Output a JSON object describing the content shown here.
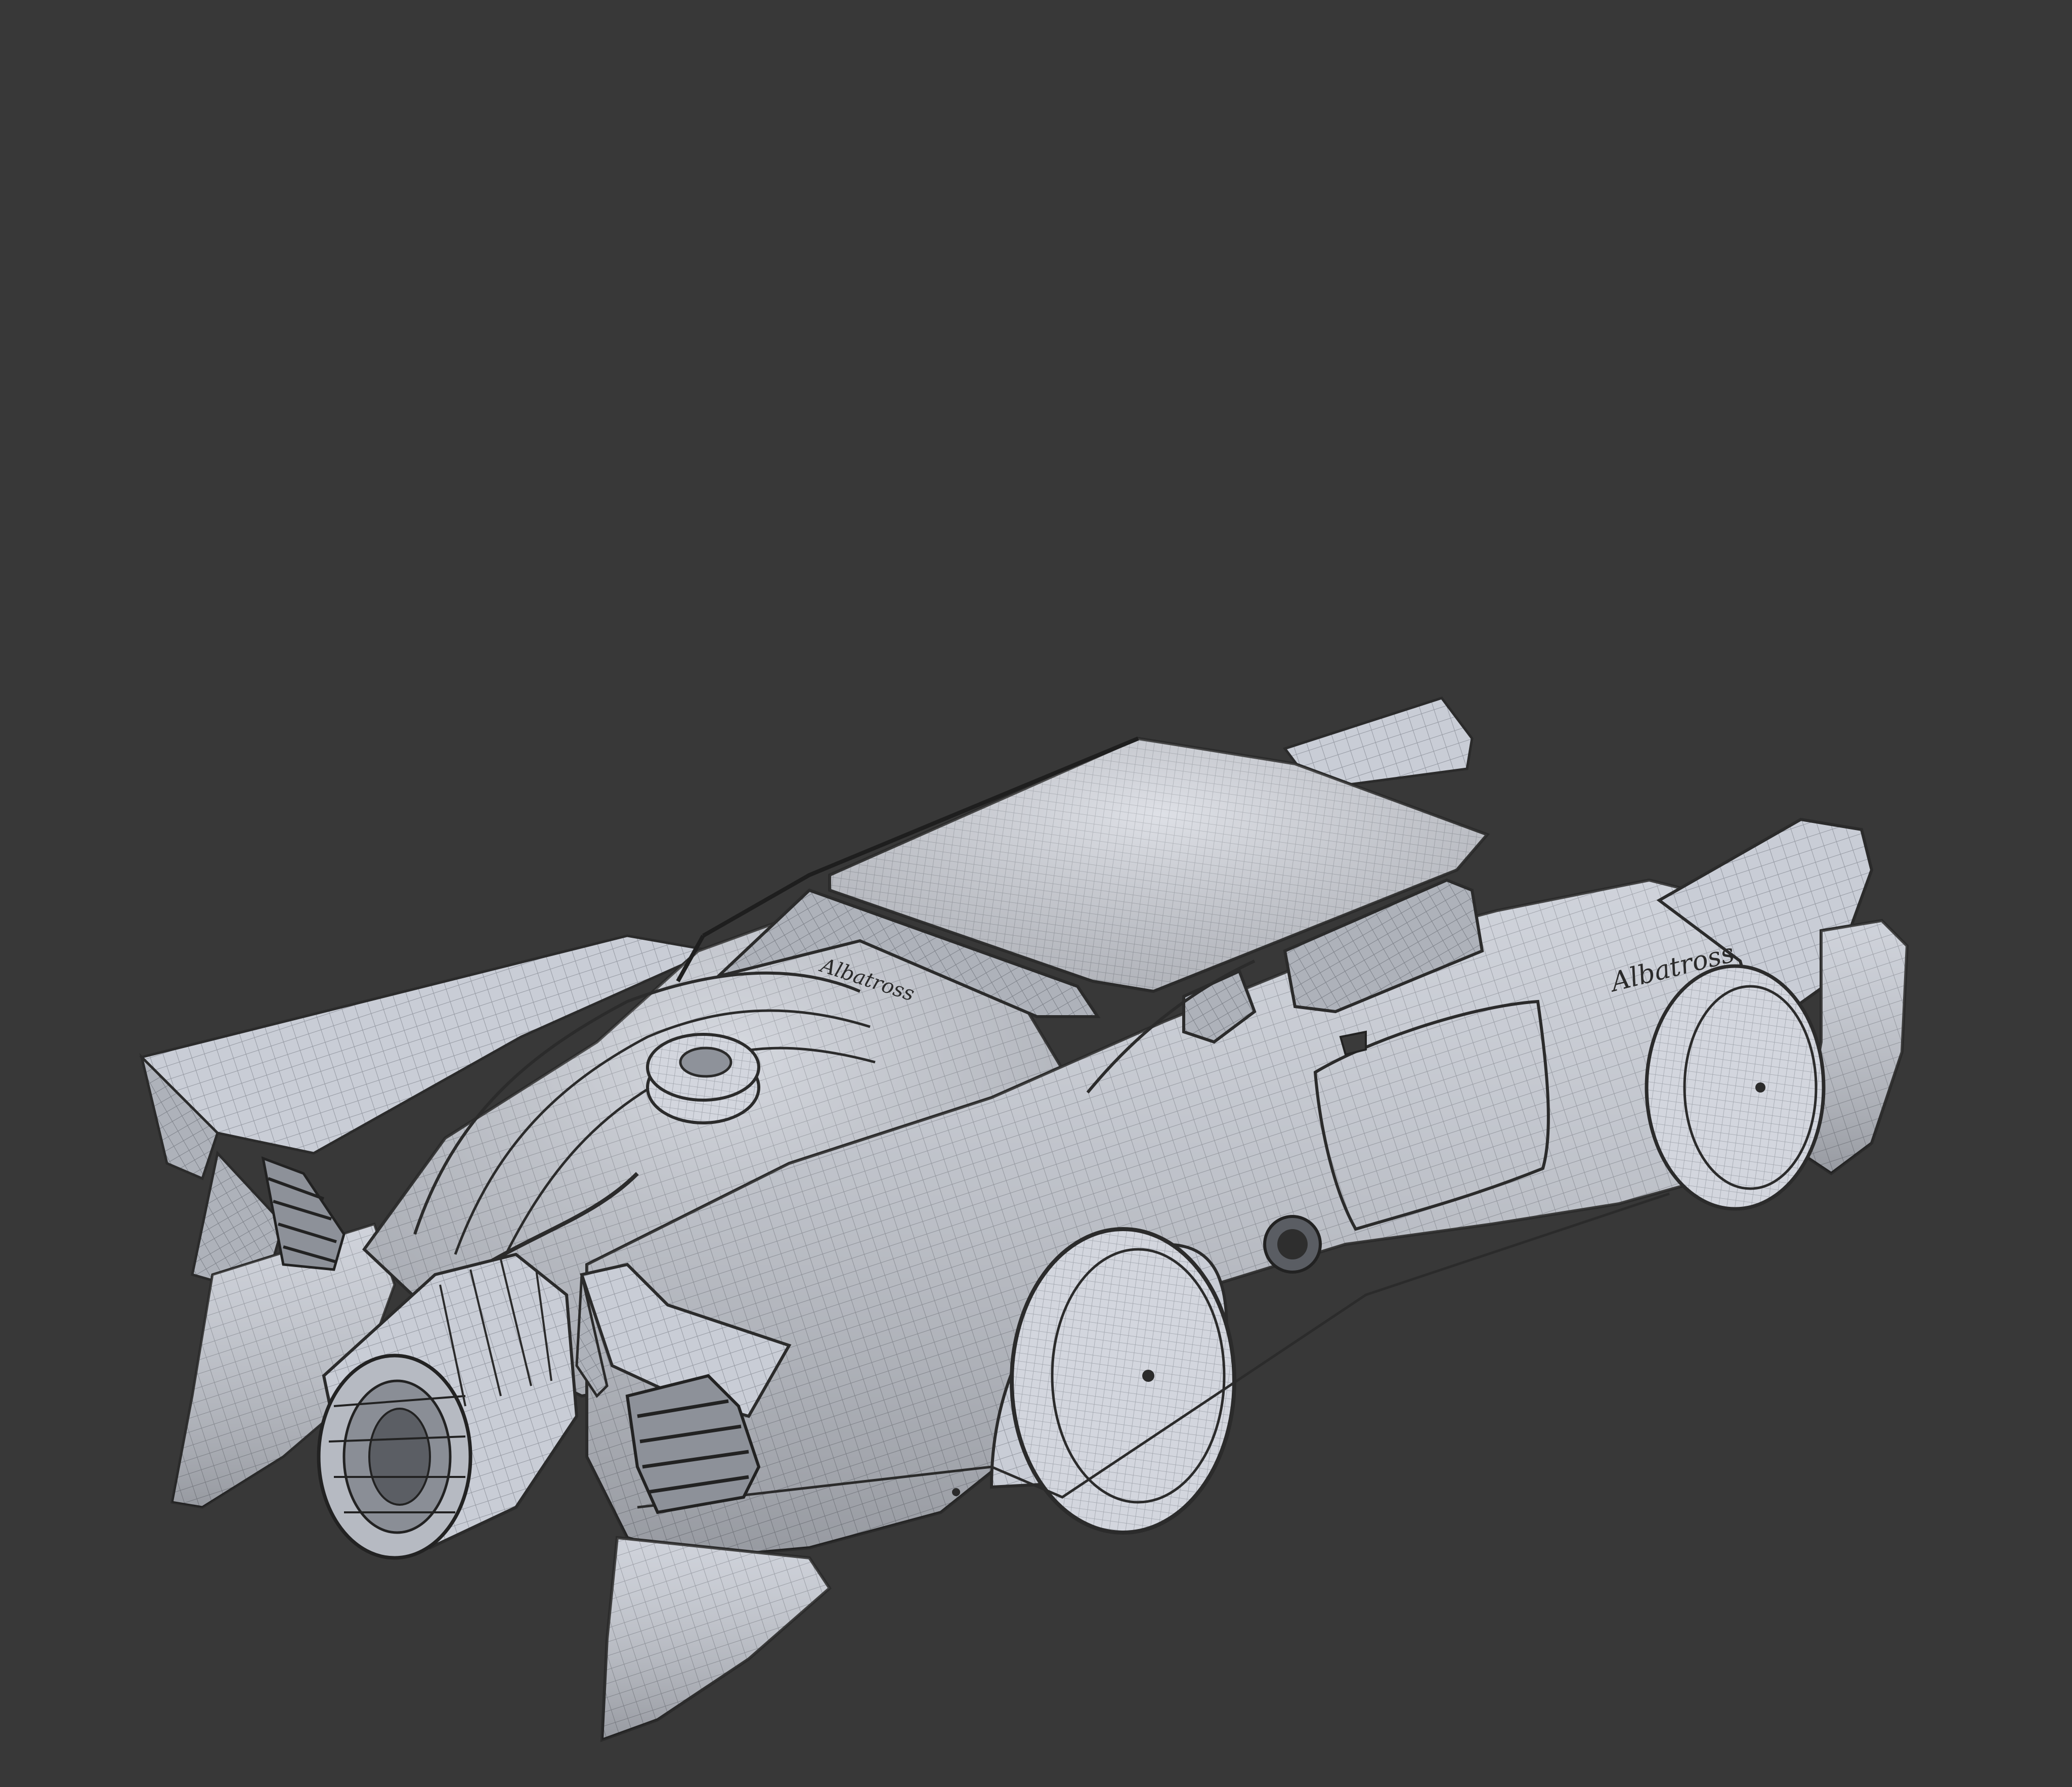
{
  "scene": {
    "background_color": "#383838",
    "model_color": "#c9cdd6",
    "wire_color": "#8f939b",
    "edge_color": "#2b2b2b",
    "subject": "hover-car",
    "render_mode": "wireframe-on-shaded"
  },
  "badges": {
    "side": "Albatross",
    "hood": "Albatross"
  }
}
